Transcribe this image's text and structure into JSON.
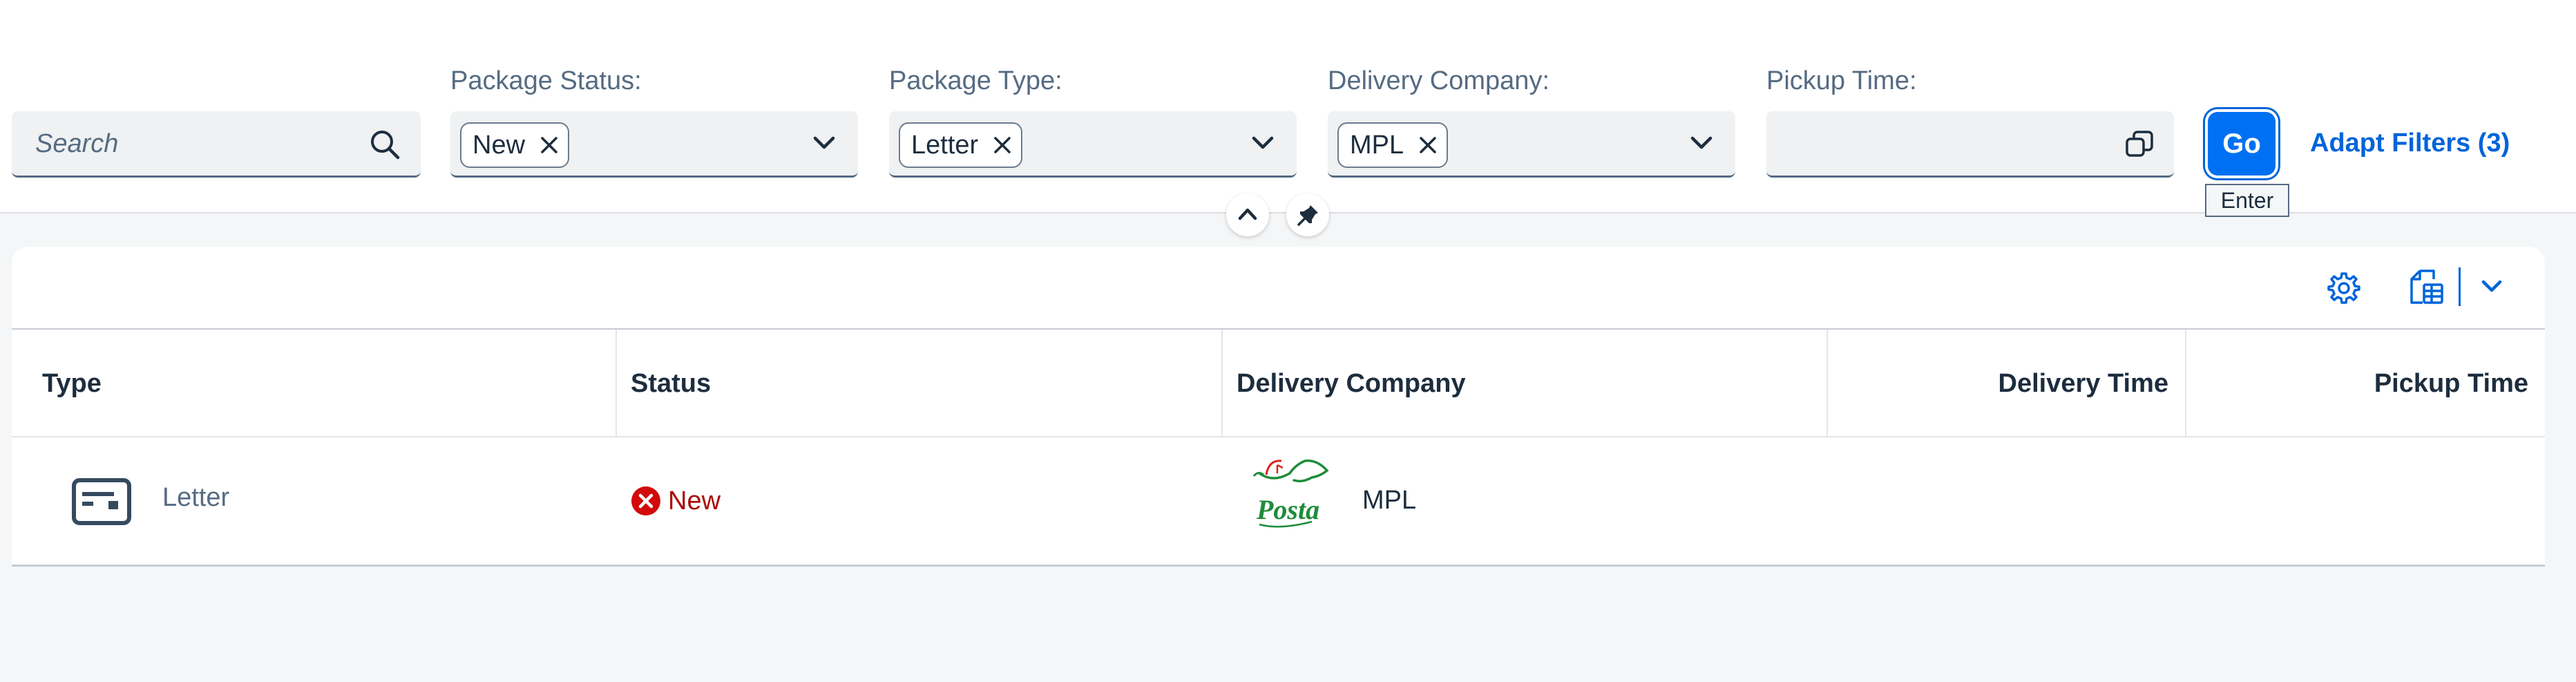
{
  "filters": {
    "search_placeholder": "Search",
    "package_status": {
      "label": "Package Status:",
      "token": "New"
    },
    "package_type": {
      "label": "Package Type:",
      "token": "Letter"
    },
    "delivery_company": {
      "label": "Delivery Company:",
      "token": "MPL"
    },
    "pickup_time": {
      "label": "Pickup Time:",
      "value": ""
    },
    "go_label": "Go",
    "go_tooltip": "Enter",
    "adapt_filters_label": "Adapt Filters (3)"
  },
  "table": {
    "columns": [
      "Type",
      "Status",
      "Delivery Company",
      "Delivery Time",
      "Pickup Time"
    ],
    "rows": [
      {
        "type": "Letter",
        "type_icon": "letter-icon",
        "status": "New",
        "status_icon": "error-icon",
        "delivery_company": "MPL",
        "company_logo": "posta-logo",
        "logo_text": "Posta",
        "delivery_time": "",
        "pickup_time": ""
      }
    ]
  },
  "icons": {
    "search": "search-icon",
    "dropdown": "chevron-down-icon",
    "token_remove": "close-icon",
    "value_help": "value-help-icon",
    "collapse": "chevron-up-icon",
    "pin": "pin-icon",
    "settings": "gear-icon",
    "export": "export-icon",
    "export_menu": "chevron-down-icon"
  },
  "colors": {
    "accent": "#0070f2",
    "link": "#0064d9",
    "negative": "#aa0808",
    "error_icon": "#d20a0a",
    "logo_green": "#1e8c3a",
    "logo_red": "#d9261c"
  }
}
